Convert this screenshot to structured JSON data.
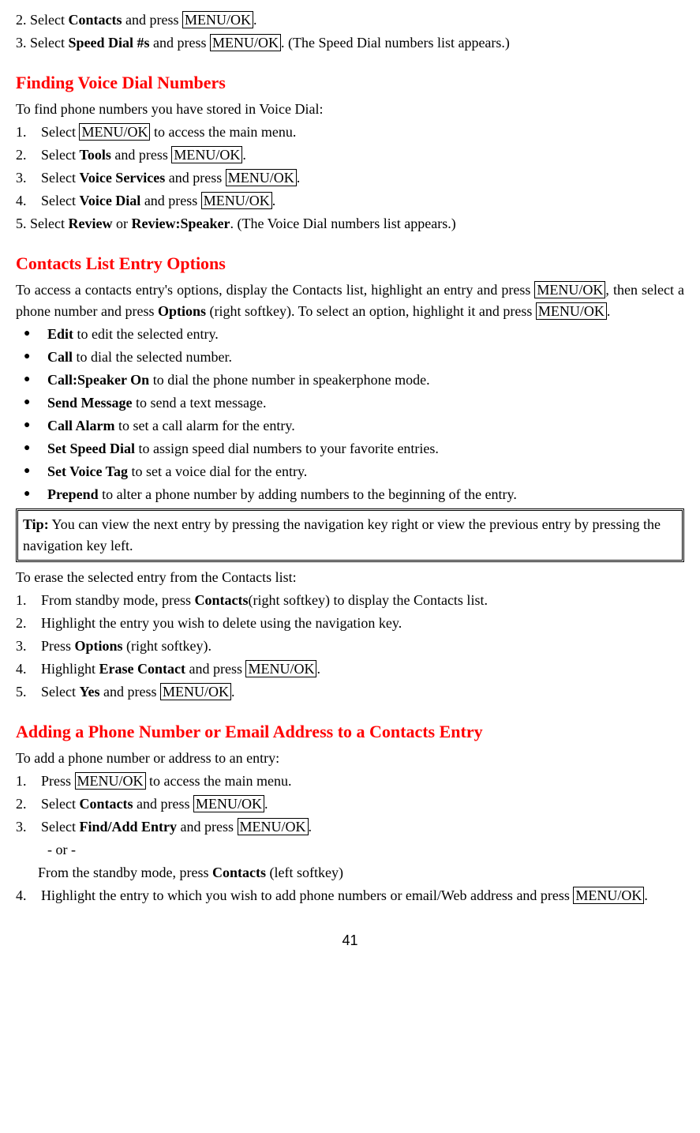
{
  "top": {
    "line2": {
      "num": "2. Select ",
      "bold1": "Contacts",
      "mid": " and press ",
      "box1": "MENU/OK",
      "end": "."
    },
    "line3": {
      "num": "3. Select ",
      "bold1": "Speed Dial #s",
      "mid": " and press ",
      "box1": "MENU/OK",
      "end": ". (The Speed Dial numbers list appears.)"
    }
  },
  "section1": {
    "heading": "Finding Voice Dial Numbers",
    "intro": "To find phone numbers you have stored in Voice Dial:",
    "item1": {
      "num": "1.",
      "pre": "Select ",
      "box1": "MENU/OK",
      "post": " to access the main menu."
    },
    "item2": {
      "num": "2.",
      "pre": "Select ",
      "bold1": "Tools",
      "mid": " and press ",
      "box1": "MENU/OK",
      "end": "."
    },
    "item3": {
      "num": "3.",
      "pre": " Select ",
      "bold1": "Voice Services",
      "mid": " and press ",
      "box1": "MENU/OK",
      "end": "."
    },
    "item4": {
      "num": "4.",
      "pre": " Select ",
      "bold1": "Voice Dial",
      "mid": " and press ",
      "box1": "MENU/OK",
      "end": "."
    },
    "item5": {
      "pre": "5. Select ",
      "bold1": "Review",
      "mid1": " or ",
      "bold2": "Review:Speaker",
      "end": ". (The Voice Dial numbers list appears.)"
    }
  },
  "section2": {
    "heading": "Contacts List Entry Options",
    "intro": {
      "p1": "To access a contacts entry's options, display the Contacts list, highlight an entry and press ",
      "box1": "MENU/OK",
      "p2": ", then select a phone number and press ",
      "bold1": "Options",
      "p3": " (right softkey). To select an option, highlight it and press ",
      "box2": "MENU/OK",
      "p4": "."
    },
    "bullets": {
      "b1": {
        "bold": "Edit",
        "rest": " to edit the selected entry."
      },
      "b2": {
        "bold": "Call",
        "rest": " to dial the selected number."
      },
      "b3": {
        "bold": "Call:Speaker On",
        "rest": " to dial the phone number in speakerphone mode."
      },
      "b4": {
        "bold": "Send Message",
        "rest": " to send a text message."
      },
      "b5": {
        "bold": "Call Alarm",
        "rest": " to set a call alarm for the entry."
      },
      "b6": {
        "bold": "Set Speed Dial",
        "rest": " to assign speed dial numbers to your favorite entries."
      },
      "b7": {
        "bold": "Set Voice Tag",
        "rest": " to set a voice dial for the entry."
      },
      "b8": {
        "bold": "Prepend",
        "rest": " to alter a phone number by adding numbers to the beginning of the entry."
      }
    },
    "tip": {
      "bold": "Tip:",
      "rest": " You can view the next entry by pressing the navigation key right or view the previous entry by pressing the navigation key left."
    },
    "erase": {
      "intro": "To erase the selected entry from the Contacts list:",
      "item1": {
        "num": "1.",
        "pre": "From standby mode, press ",
        "bold1": "Contacts",
        "post": "(right softkey) to display the Contacts list."
      },
      "item2": {
        "num": "2.",
        "txt": "Highlight the entry you wish to delete using the navigation key."
      },
      "item3": {
        "num": "3.",
        "pre": "Press ",
        "bold1": "Options",
        "post": " (right softkey)."
      },
      "item4": {
        "num": "4.",
        "pre": "Highlight ",
        "bold1": "Erase Contact",
        "mid": " and press ",
        "box1": "MENU/OK",
        "end": "."
      },
      "item5": {
        "num": "5.",
        "pre": "Select ",
        "bold1": "Yes",
        "mid": " and press ",
        "box1": "MENU/OK",
        "end": "."
      }
    }
  },
  "section3": {
    "heading": "Adding a Phone Number or Email Address to a Contacts Entry",
    "intro": "To add a phone number or address to an entry:",
    "item1": {
      "num": "1.",
      "pre": "Press ",
      "box1": "MENU/OK",
      "post": " to access the main menu."
    },
    "item2": {
      "num": "2.",
      "pre": "Select ",
      "bold1": "Contacts",
      "mid": " and press ",
      "box1": "MENU/OK",
      "end": "."
    },
    "item3": {
      "num": "3.",
      "pre": "Select ",
      "bold1": "Find/Add Entry",
      "mid": " and press ",
      "box1": "MENU/OK",
      "end": "."
    },
    "or": "- or -",
    "orline": {
      "pre": "From the standby mode, press ",
      "bold1": "Contacts",
      "post": " (left softkey)"
    },
    "item4": {
      "num": "4.",
      "pre": "Highlight the entry to which you wish to add phone numbers or email/Web address and press ",
      "box1": "MENU/OK",
      "end": "."
    }
  },
  "pagenum": "41"
}
